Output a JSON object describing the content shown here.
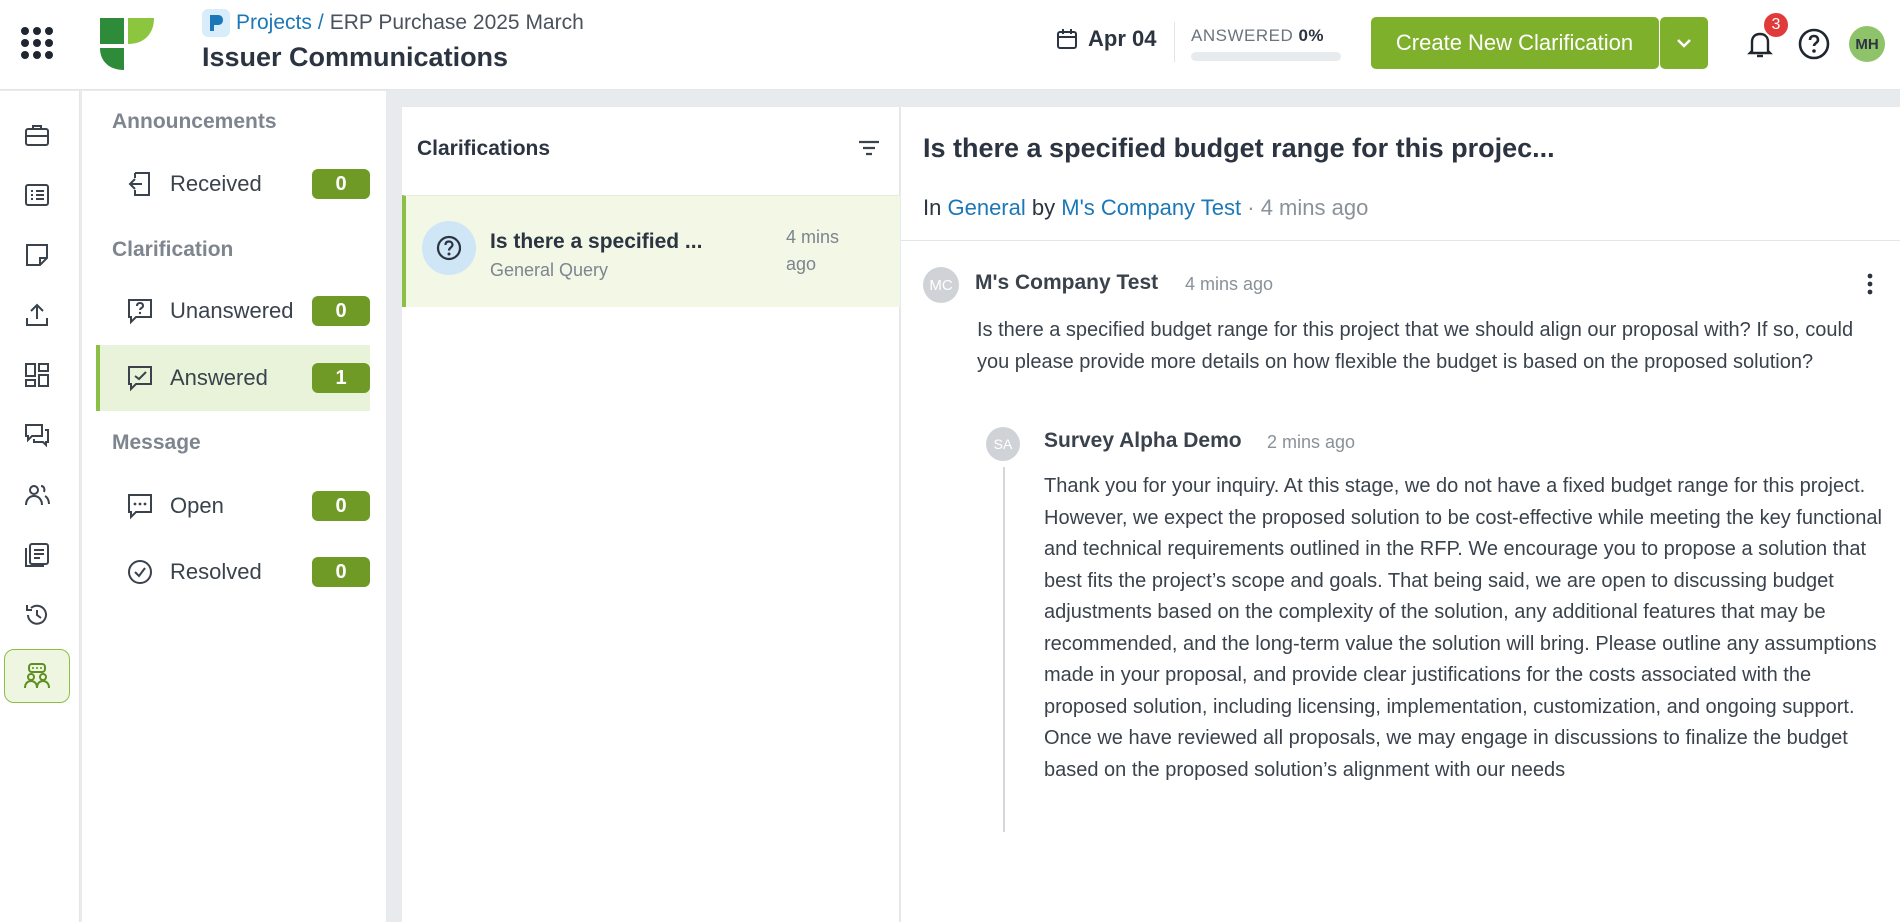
{
  "header": {
    "breadcrumb": {
      "projects": "Projects",
      "separator": "/",
      "current": "ERP Purchase 2025 March"
    },
    "title": "Issuer Communications",
    "date": "Apr 04",
    "answered_label": "ANSWERED",
    "answered_percent": "0%",
    "answered_fraction": 0,
    "create_button": "Create New Clarification",
    "notification_count": "3",
    "user_initials": "MH"
  },
  "colors": {
    "accent": "#7fb02b",
    "badge": "#6f9a25",
    "link": "#1b78b8",
    "alert": "#e03a3a"
  },
  "rail": {
    "icons": [
      "briefcase-icon",
      "list-icon",
      "notes-icon",
      "upload-icon",
      "dashboard-icon",
      "chat-icon",
      "users-icon",
      "documents-icon",
      "history-icon",
      "communications-icon"
    ],
    "active": "communications-icon"
  },
  "nav": {
    "sections": {
      "announcements": "Announcements",
      "clarification": "Clarification",
      "message": "Message"
    },
    "items": [
      {
        "label": "Received",
        "count": "0"
      },
      {
        "label": "Unanswered",
        "count": "0"
      },
      {
        "label": "Answered",
        "count": "1"
      },
      {
        "label": "Open",
        "count": "0"
      },
      {
        "label": "Resolved",
        "count": "0"
      }
    ],
    "active": "Answered"
  },
  "list": {
    "title": "Clarifications",
    "items": [
      {
        "title": "Is there a specified ...",
        "category": "General Query",
        "time": "4 mins ago"
      }
    ]
  },
  "detail": {
    "title": "Is there a specified budget range for this projec...",
    "meta": {
      "in": "In",
      "category": "General",
      "by": "by",
      "company": "M's Company Test",
      "time": "· 4 mins ago"
    },
    "post": {
      "initials": "MC",
      "author": "M's Company Test",
      "time": "4 mins ago",
      "body": "Is there a specified budget range for this project that we should align our proposal with? If so, could you please provide more details on how flexible the budget is based on the proposed solution?"
    },
    "reply": {
      "initials": "SA",
      "author": "Survey Alpha Demo",
      "time": "2 mins ago",
      "body": "Thank you for your inquiry. At this stage, we do not have a fixed budget range for this project. However, we expect the proposed solution to be cost-effective while meeting the key functional and technical requirements outlined in the RFP. We encourage you to propose a solution that best fits the project’s scope and goals. That being said, we are open to discussing budget adjustments based on the complexity of the solution, any additional features that may be recommended, and the long-term value the solution will bring. Please outline any assumptions made in your proposal, and provide clear justifications for the costs associated with the proposed solution, including licensing, implementation, customization, and ongoing support. Once we have reviewed all proposals, we may engage in discussions to finalize the budget based on the proposed solution’s alignment with our needs"
    }
  }
}
